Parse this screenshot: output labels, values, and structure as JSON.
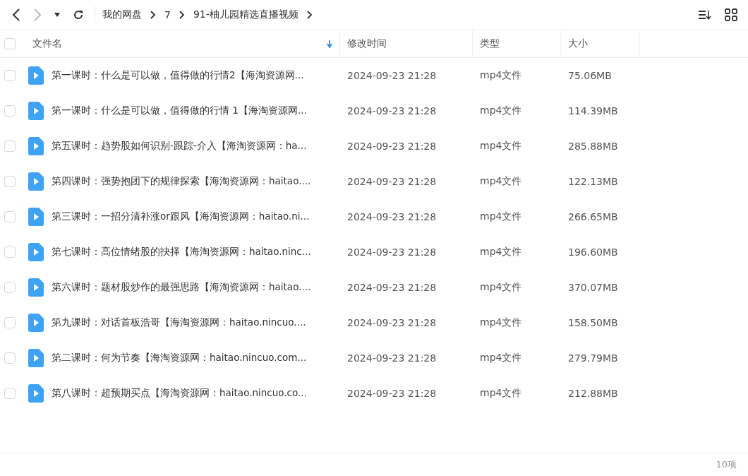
{
  "breadcrumb": [
    {
      "label": "我的网盘"
    },
    {
      "label": "7"
    },
    {
      "label": "91-柚儿园精选直播视频"
    }
  ],
  "table": {
    "select_all": {
      "checked": false
    },
    "columns": [
      {
        "label": "文件名",
        "sorted": true
      },
      {
        "label": "修改时间",
        "sorted": false
      },
      {
        "label": "类型",
        "sorted": false
      },
      {
        "label": "大小",
        "sorted": false
      }
    ],
    "rows": [
      {
        "checked": false,
        "name": "第一课时：什么是可以做，值得做的行情2【海淘资源网...",
        "modified": "2024-09-23 21:28",
        "type": "mp4文件",
        "size": "75.06MB"
      },
      {
        "checked": false,
        "name": "第一课时：什么是可以做，值得做的行情 1【海淘资源网...",
        "modified": "2024-09-23 21:28",
        "type": "mp4文件",
        "size": "114.39MB"
      },
      {
        "checked": false,
        "name": "第五课时：趋势股如何识别-跟踪-介入【海淘资源网：ha...",
        "modified": "2024-09-23 21:28",
        "type": "mp4文件",
        "size": "285.88MB"
      },
      {
        "checked": false,
        "name": "第四课时：强势抱团下的规律探索【海淘资源网：haitao....",
        "modified": "2024-09-23 21:28",
        "type": "mp4文件",
        "size": "122.13MB"
      },
      {
        "checked": false,
        "name": "第三课时：一招分清补涨or跟风【海淘资源网：haitao.ni...",
        "modified": "2024-09-23 21:28",
        "type": "mp4文件",
        "size": "266.65MB"
      },
      {
        "checked": false,
        "name": "第七课时：高位情绪股的抉择【海淘资源网：haitao.ninc...",
        "modified": "2024-09-23 21:28",
        "type": "mp4文件",
        "size": "196.60MB"
      },
      {
        "checked": false,
        "name": "第六课时：题材股炒作的最强思路【海淘资源网：haitao....",
        "modified": "2024-09-23 21:28",
        "type": "mp4文件",
        "size": "370.07MB"
      },
      {
        "checked": false,
        "name": "第九课时：对话首板浩哥【海淘资源网：haitao.nincuo....",
        "modified": "2024-09-23 21:28",
        "type": "mp4文件",
        "size": "158.50MB"
      },
      {
        "checked": false,
        "name": "第二课时：何为节奏【海淘资源网：haitao.nincuo.com...",
        "modified": "2024-09-23 21:28",
        "type": "mp4文件",
        "size": "279.79MB"
      },
      {
        "checked": false,
        "name": "第八课时：超预期买点【海淘资源网：haitao.nincuo.co...",
        "modified": "2024-09-23 21:28",
        "type": "mp4文件",
        "size": "212.88MB"
      }
    ]
  },
  "status_bar": {
    "count": "10项"
  }
}
